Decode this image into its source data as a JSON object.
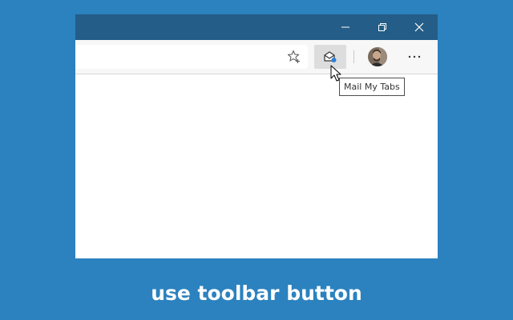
{
  "window_controls": {
    "minimize_icon": "minimize-icon",
    "maximize_icon": "restore-icon",
    "close_icon": "close-icon"
  },
  "toolbar": {
    "favorite_icon": "star-add-icon",
    "extension_icon": "mail-my-tabs-icon",
    "profile_icon": "avatar",
    "more_icon": "ellipsis-icon"
  },
  "tooltip": {
    "text": "Mail My Tabs"
  },
  "caption": {
    "text": "use toolbar button"
  },
  "colors": {
    "background": "#2b82bf",
    "titlebar": "#245d87",
    "toolbar": "#f7f7f7",
    "extension_button_hover": "#dddddd",
    "caption_text": "#ffffff"
  }
}
